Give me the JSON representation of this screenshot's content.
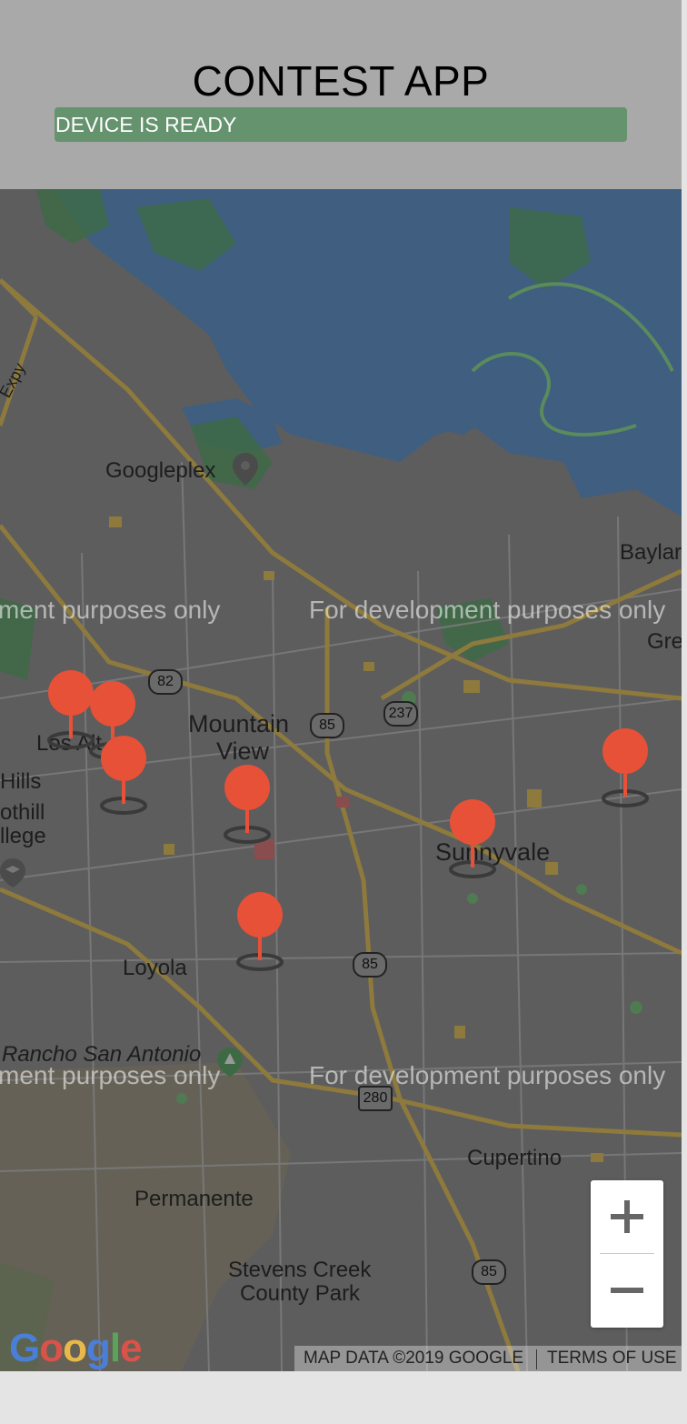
{
  "app": {
    "title": "CONTEST APP",
    "status": "DEVICE IS READY"
  },
  "colors": {
    "header_bg": "#a9a9a9",
    "status_bg": "#64936e",
    "water": "#3f5e80",
    "land": "#5d5d5d",
    "roads": "#8d7a3c",
    "marker": "#e75137"
  },
  "map": {
    "places": {
      "googleplex": "Googleplex",
      "mountain_view": "Mountain",
      "mountain_view_2": "View",
      "los_altos": "Los Alt",
      "hills": "Hills",
      "foothill": "othill",
      "college": "llege",
      "loyola": "Loyola",
      "rancho": "Rancho San Antonio",
      "sunnyvale": "Sunnyvale",
      "baylands": "Baylar",
      "gre": "Gre",
      "cupertino": "Cupertino",
      "permanente": "Permanente",
      "stevens_creek": "Stevens Creek",
      "county_park": "County Park",
      "expy": "Expy"
    },
    "watermark_left": "ment purposes only",
    "watermark_right": "For development purposes only",
    "shields": [
      "82",
      "85",
      "237",
      "85",
      "85",
      "280",
      "85"
    ],
    "markers": [
      "marker-1",
      "marker-2",
      "marker-3",
      "marker-4",
      "marker-5",
      "marker-6",
      "marker-7"
    ],
    "zoom_in_icon": "plus-icon",
    "zoom_out_icon": "minus-icon",
    "attribution": "MAP DATA ©2019 GOOGLE",
    "terms": "TERMS OF USE",
    "logo": "Google"
  }
}
